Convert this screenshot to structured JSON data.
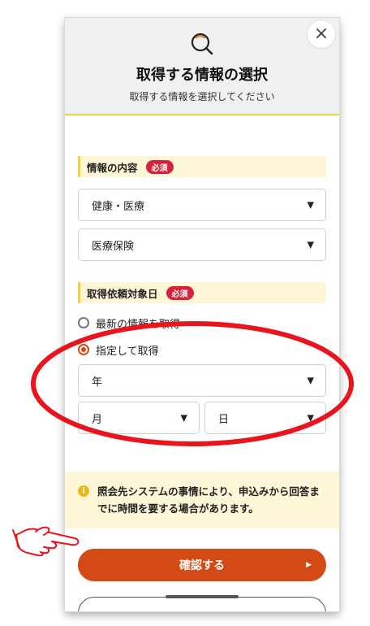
{
  "header": {
    "title": "取得する情報の選択",
    "subtitle": "取得する情報を選択してください",
    "close_icon": "close-icon",
    "close_glyph": "×",
    "search_icon": "search-icon"
  },
  "sections": {
    "info_content": {
      "label": "情報の内容",
      "required_badge": "必須",
      "select_1": {
        "value": "健康・医療"
      },
      "select_2": {
        "value": "医療保険"
      }
    },
    "target_date": {
      "label": "取得依頼対象日",
      "required_badge": "必須",
      "radio_latest": {
        "label": "最新の情報を取得",
        "checked": false
      },
      "radio_specified": {
        "label": "指定して取得",
        "checked": true
      },
      "year_select": {
        "value": "年"
      },
      "month_select": {
        "value": "月"
      },
      "day_select": {
        "value": "日"
      }
    }
  },
  "caret_glyph": "▼",
  "notice": {
    "icon": "info-icon",
    "icon_glyph": "i",
    "text": "照会先システムの事情により、申込みから回答までに時間を要する場合があります。"
  },
  "confirm_button": {
    "label": "確認する",
    "arrow_glyph": "▶"
  },
  "colors": {
    "accent_orange": "#d34a17",
    "required_red": "#d8203a",
    "highlight_yellow": "#f3d33c",
    "label_bg": "#fdf6d7",
    "annotation_red": "#e8141e"
  }
}
